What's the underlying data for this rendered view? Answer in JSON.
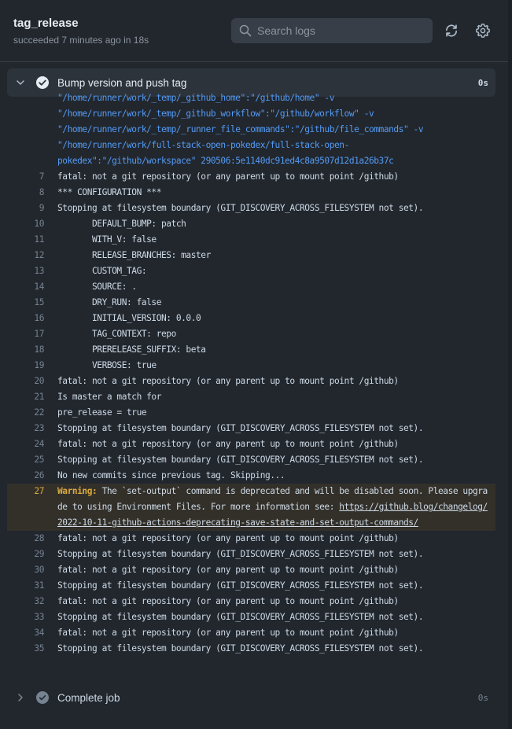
{
  "header": {
    "title": "tag_release",
    "subtitle": "succeeded 7 minutes ago in 18s",
    "search_placeholder": "Search logs",
    "search_value": "",
    "refresh_icon": "sync-icon",
    "settings_icon": "gear-icon"
  },
  "steps": [
    {
      "name": "Bump version and push tag",
      "duration": "0s",
      "status": "success",
      "expanded": true
    },
    {
      "name": "Complete job",
      "duration": "0s",
      "status": "success",
      "expanded": false
    }
  ],
  "log": {
    "continuation_lines": [
      "\"/home/runner/work/_temp/_github_home\":\"/github/home\" -v",
      "\"/home/runner/work/_temp/_github_workflow\":\"/github/workflow\" -v",
      "\"/home/runner/work/_temp/_runner_file_commands\":\"/github/file_commands\" -v",
      "\"/home/runner/work/full-stack-open-pokedex/full-stack-open-",
      "pokedex\":\"/github/workspace\" 290506:5e1140dc91ed4c8a9507d12d1a26b37c"
    ],
    "lines": [
      {
        "num": "7",
        "text": "fatal: not a git repository (or any parent up to mount point /github)"
      },
      {
        "num": "8",
        "text": "*** CONFIGURATION ***"
      },
      {
        "num": "9",
        "text": "Stopping at filesystem boundary (GIT_DISCOVERY_ACROSS_FILESYSTEM not set)."
      },
      {
        "num": "10",
        "text": "\tDEFAULT_BUMP: patch"
      },
      {
        "num": "11",
        "text": "\tWITH_V: false"
      },
      {
        "num": "12",
        "text": "\tRELEASE_BRANCHES: master"
      },
      {
        "num": "13",
        "text": "\tCUSTOM_TAG:"
      },
      {
        "num": "14",
        "text": "\tSOURCE: ."
      },
      {
        "num": "15",
        "text": "\tDRY_RUN: false"
      },
      {
        "num": "16",
        "text": "\tINITIAL_VERSION: 0.0.0"
      },
      {
        "num": "17",
        "text": "\tTAG_CONTEXT: repo"
      },
      {
        "num": "18",
        "text": "\tPRERELEASE_SUFFIX: beta"
      },
      {
        "num": "19",
        "text": "\tVERBOSE: true"
      },
      {
        "num": "20",
        "text": "fatal: not a git repository (or any parent up to mount point /github)"
      },
      {
        "num": "21",
        "text": "Is master a match for"
      },
      {
        "num": "22",
        "text": "pre_release = true"
      },
      {
        "num": "23",
        "text": "Stopping at filesystem boundary (GIT_DISCOVERY_ACROSS_FILESYSTEM not set)."
      },
      {
        "num": "24",
        "text": "fatal: not a git repository (or any parent up to mount point /github)"
      },
      {
        "num": "25",
        "text": "Stopping at filesystem boundary (GIT_DISCOVERY_ACROSS_FILESYSTEM not set)."
      },
      {
        "num": "26",
        "text": "No new commits since previous tag. Skipping..."
      }
    ],
    "warning": {
      "num": "27",
      "label": "Warning:",
      "text": " The `set-output` command is deprecated and will be disabled soon. Please upgrade to using Environment Files. For more information see: ",
      "link": "https://github.blog/changelog/2022-10-11-github-actions-deprecating-save-state-and-set-output-commands/"
    },
    "lines_after": [
      {
        "num": "28",
        "text": "fatal: not a git repository (or any parent up to mount point /github)"
      },
      {
        "num": "29",
        "text": "Stopping at filesystem boundary (GIT_DISCOVERY_ACROSS_FILESYSTEM not set)."
      },
      {
        "num": "30",
        "text": "fatal: not a git repository (or any parent up to mount point /github)"
      },
      {
        "num": "31",
        "text": "Stopping at filesystem boundary (GIT_DISCOVERY_ACROSS_FILESYSTEM not set)."
      },
      {
        "num": "32",
        "text": "fatal: not a git repository (or any parent up to mount point /github)"
      },
      {
        "num": "33",
        "text": "Stopping at filesystem boundary (GIT_DISCOVERY_ACROSS_FILESYSTEM not set)."
      },
      {
        "num": "34",
        "text": "fatal: not a git repository (or any parent up to mount point /github)"
      },
      {
        "num": "35",
        "text": "Stopping at filesystem boundary (GIT_DISCOVERY_ACROSS_FILESYSTEM not set)."
      }
    ]
  },
  "colors": {
    "background": "#22272e",
    "warning": "#daaa3f",
    "link_blue": "#539bf5",
    "success_check": "#e6edf3"
  }
}
